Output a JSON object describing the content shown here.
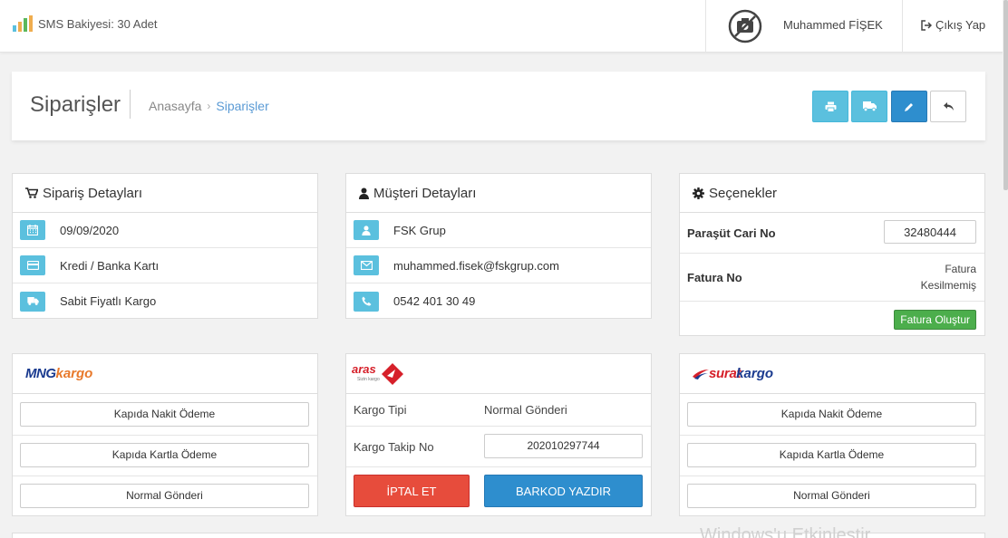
{
  "topbar": {
    "sms_balance": "SMS Bakiyesi: 30 Adet",
    "username": "Muhammed FİŞEK",
    "logout_label": "Çıkış Yap"
  },
  "page": {
    "title": "Siparişler",
    "breadcrumb": [
      {
        "label": "Anasayfa"
      },
      {
        "label": "Siparişler"
      }
    ],
    "breadcrumb_separator": "›"
  },
  "colors": {
    "info": "#5bc0de",
    "primary": "#2e8ece",
    "danger": "#e74c3c",
    "success": "#4cae4c"
  },
  "order_details": {
    "title": "Sipariş Detayları",
    "rows": [
      {
        "icon": "calendar-icon",
        "value": "09/09/2020"
      },
      {
        "icon": "credit-card-icon",
        "value": "Kredi / Banka Kartı"
      },
      {
        "icon": "truck-icon",
        "value": "Sabit Fiyatlı Kargo"
      }
    ]
  },
  "customer_details": {
    "title": "Müşteri Detayları",
    "rows": [
      {
        "icon": "user-icon",
        "value": "FSK Grup"
      },
      {
        "icon": "envelope-icon",
        "value": "muhammed.fisek@fskgrup.com"
      },
      {
        "icon": "phone-icon",
        "value": "0542 401 30 49"
      }
    ]
  },
  "options": {
    "title": "Seçenekler",
    "parasut_label": "Paraşüt Cari No",
    "parasut_value": "32480444",
    "invoice_label": "Fatura No",
    "invoice_status_line1": "Fatura",
    "invoice_status_line2": "Kesilmemiş",
    "create_invoice_label": "Fatura Oluştur"
  },
  "mng": {
    "logo_text_1": "MNG",
    "logo_text_2": "kargo",
    "buttons": [
      "Kapıda Nakit Ödeme",
      "Kapıda Kartla Ödeme",
      "Normal Gönderi"
    ]
  },
  "aras": {
    "logo_text": "aras",
    "logo_subtext": "Sizin kargo",
    "cargo_type_label": "Kargo Tipi",
    "cargo_type_value": "Normal Gönderi",
    "tracking_label": "Kargo Takip No",
    "tracking_value": "202010297744",
    "cancel_label": "İPTAL ET",
    "barcode_label": "BARKOD YAZDIR"
  },
  "surat": {
    "logo_text_1": "surat",
    "logo_text_2": "kargo",
    "buttons": [
      "Kapıda Nakit Ödeme",
      "Kapıda Kartla Ödeme",
      "Normal Gönderi"
    ]
  },
  "watermark": "Windows'u Etkinleştir"
}
